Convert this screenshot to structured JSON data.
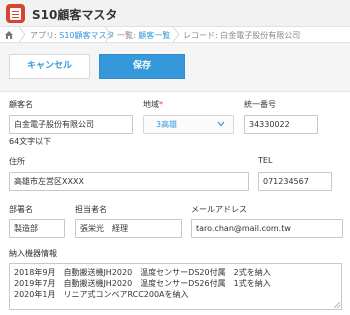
{
  "app": {
    "title": "S10顧客マスタ",
    "icon": "app-list-icon"
  },
  "breadcrumb": {
    "home_icon": "home-icon",
    "app_prefix": "アプリ: ",
    "app_name": "S10顧客マスタ",
    "list_prefix": "一覧: ",
    "list_name": "顧客一覧",
    "record_text": "レコード: 白金電子股份有限公司"
  },
  "toolbar": {
    "cancel_label": "キャンセル",
    "save_label": "保存"
  },
  "form": {
    "customer_name": {
      "label": "顧客名",
      "value": "白金電子股份有限公司",
      "hint": "64文字以下"
    },
    "region": {
      "label": "地域",
      "required_mark": "*",
      "value": "3高雄"
    },
    "tax_id": {
      "label": "統一番号",
      "value": "34330022"
    },
    "address": {
      "label": "住所",
      "value": "高雄市左営区XXXX"
    },
    "tel": {
      "label": "TEL",
      "value": "071234567"
    },
    "department": {
      "label": "部署名",
      "value": "製造部"
    },
    "contact": {
      "label": "担当者名",
      "value": "張栄光　経理"
    },
    "email": {
      "label": "メールアドレス",
      "value": "taro.chan@mail.com.tw"
    },
    "delivery": {
      "label": "納入機器情報",
      "lines": [
        "2018年9月　自動搬送機JH2020　温度センサーDS20付属　2式を納入",
        "2019年7月　自動搬送機JH2020　温度センサーDS26付属　1式を納入",
        "2020年1月　リニア式コンベアRCC200Aを納入"
      ]
    }
  },
  "colors": {
    "accent": "#3498db",
    "app_icon": "#d9432f",
    "required": "#e74c3c"
  }
}
